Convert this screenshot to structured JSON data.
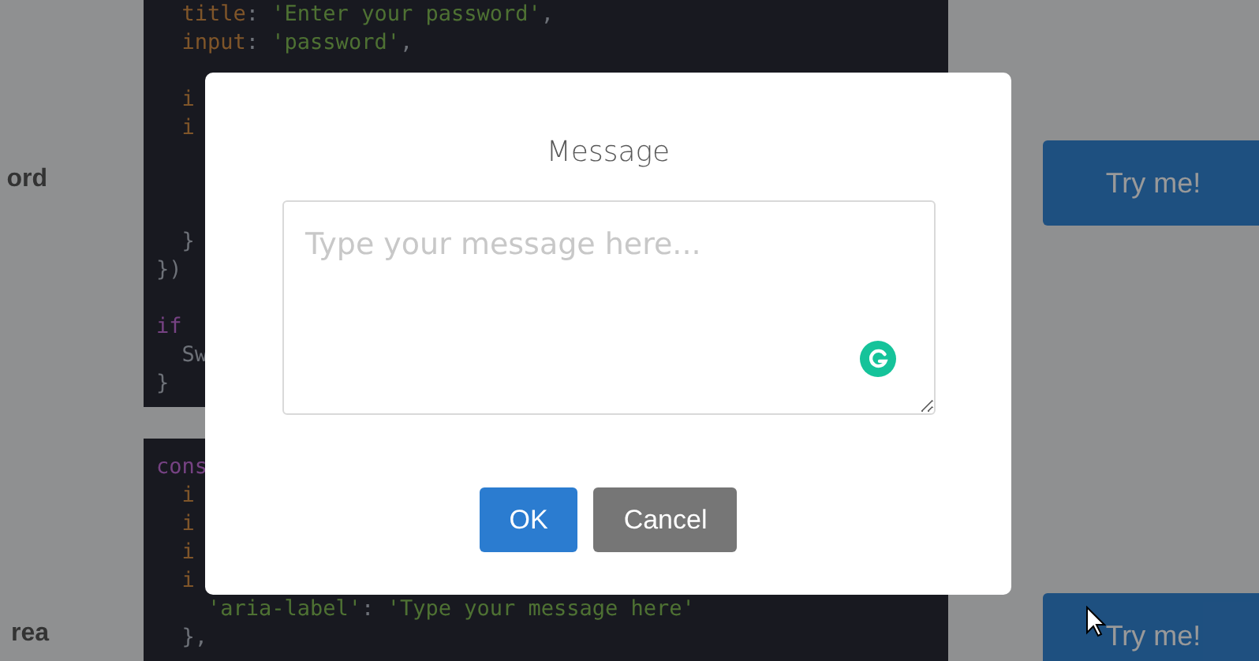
{
  "sections": [
    {
      "label": "ord",
      "button": "Try me!",
      "code": [
        {
          "lines": [
            [
              {
                "text": "  title",
                "kind": "key"
              },
              {
                "text": ": ",
                "kind": "punct"
              },
              {
                "text": "'Enter your password'",
                "kind": "string"
              },
              {
                "text": ",",
                "kind": "punct"
              }
            ],
            [
              {
                "text": "  input",
                "kind": "key"
              },
              {
                "text": ": ",
                "kind": "punct"
              },
              {
                "text": "'password'",
                "kind": "string"
              },
              {
                "text": ",",
                "kind": "punct"
              }
            ]
          ]
        },
        {
          "lines": [
            [
              {
                "text": "  i",
                "kind": "key"
              }
            ],
            [
              {
                "text": "  i",
                "kind": "key"
              }
            ]
          ]
        },
        {
          "lines": [
            [
              {
                "text": "  }",
                "kind": "punct"
              }
            ],
            [
              {
                "text": "})",
                "kind": "punct"
              }
            ]
          ]
        },
        {
          "lines": [
            [
              {
                "text": "if",
                "kind": "keyword"
              }
            ],
            [
              {
                "text": "  Sw",
                "kind": "plain"
              }
            ],
            [
              {
                "text": "}",
                "kind": "punct"
              }
            ]
          ]
        }
      ]
    },
    {
      "label": "rea",
      "button": "Try me!",
      "code": [
        {
          "lines": [
            [
              {
                "text": "cons",
                "kind": "keyword"
              }
            ],
            [
              {
                "text": "  i",
                "kind": "key"
              }
            ],
            [
              {
                "text": "  i",
                "kind": "key"
              }
            ],
            [
              {
                "text": "  i",
                "kind": "key"
              }
            ],
            [
              {
                "text": "  i",
                "kind": "key"
              }
            ],
            [
              {
                "text": "    'aria-label'",
                "kind": "string"
              },
              {
                "text": ": ",
                "kind": "punct"
              },
              {
                "text": "'Type your message here'",
                "kind": "string"
              }
            ],
            [
              {
                "text": "  },",
                "kind": "punct"
              }
            ]
          ]
        }
      ]
    }
  ],
  "dialog": {
    "title": "Message",
    "textarea": {
      "placeholder": "Type your message here..."
    },
    "buttons": [
      {
        "label": "OK",
        "kind": "confirm"
      },
      {
        "label": "Cancel",
        "kind": "cancel"
      }
    ]
  }
}
